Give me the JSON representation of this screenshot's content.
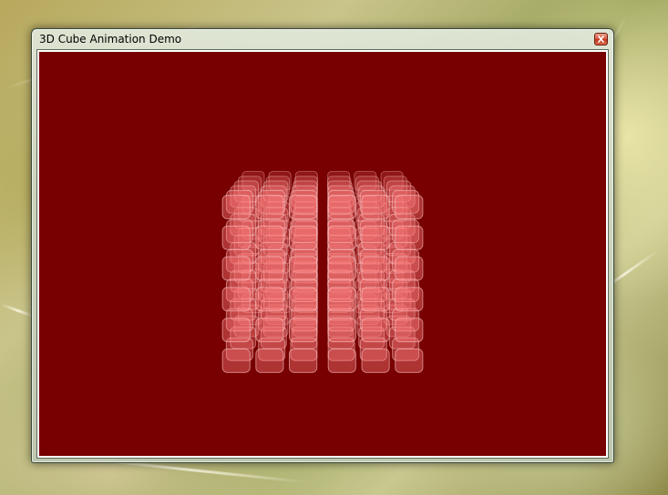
{
  "window": {
    "title": "3D Cube Animation Demo",
    "close_label": "close"
  },
  "viewport": {
    "background": "#780000",
    "cube": {
      "grid": 6,
      "layers": 6,
      "block_fill": "#ff8080",
      "block_stroke": "#ffd0d0"
    }
  },
  "icons": {
    "close": "close-icon"
  }
}
